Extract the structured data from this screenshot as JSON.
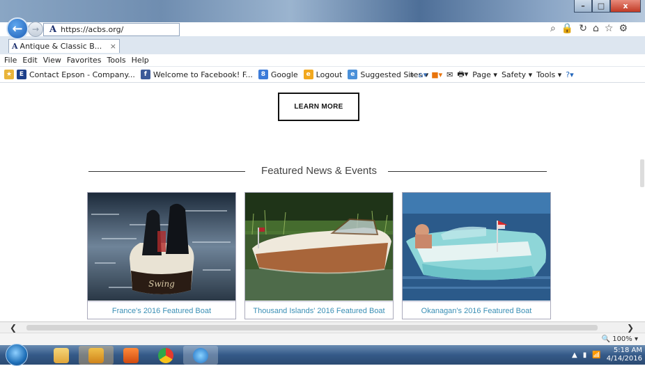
{
  "browser": {
    "url": "https://acbs.org/",
    "tab_title": "Antique & Classic B...",
    "tab_close": "×",
    "window_min": "–",
    "window_max": "□",
    "window_close": "x"
  },
  "menu": [
    "File",
    "Edit",
    "View",
    "Favorites",
    "Tools",
    "Help"
  ],
  "favorites": [
    {
      "label": "Contact Epson - Company...",
      "icon": "E",
      "color": "#1c3f8a"
    },
    {
      "label": "Welcome to Facebook! F...",
      "icon": "f",
      "color": "#3b5998"
    },
    {
      "label": "Google",
      "icon": "8",
      "color": "#3c7bd9"
    },
    {
      "label": "Logout",
      "icon": "e",
      "color": "#f2a81d"
    },
    {
      "label": "Suggested Sites ▾",
      "icon": "e",
      "color": "#4a90d9"
    }
  ],
  "command_bar": [
    "Page ▾",
    "Safety ▾",
    "Tools ▾"
  ],
  "page": {
    "learn_more": "LEARN MORE",
    "section_heading": "Featured News & Events",
    "cards": [
      {
        "caption": "France's 2016 Featured Boat",
        "stern_text": "Swing"
      },
      {
        "caption": "Thousand Islands' 2016 Featured Boat"
      },
      {
        "caption": "Okanagan's 2016 Featured Boat"
      }
    ]
  },
  "status": {
    "zoom": "100%"
  },
  "clock": {
    "time": "5:18 AM",
    "date": "4/14/2016"
  }
}
